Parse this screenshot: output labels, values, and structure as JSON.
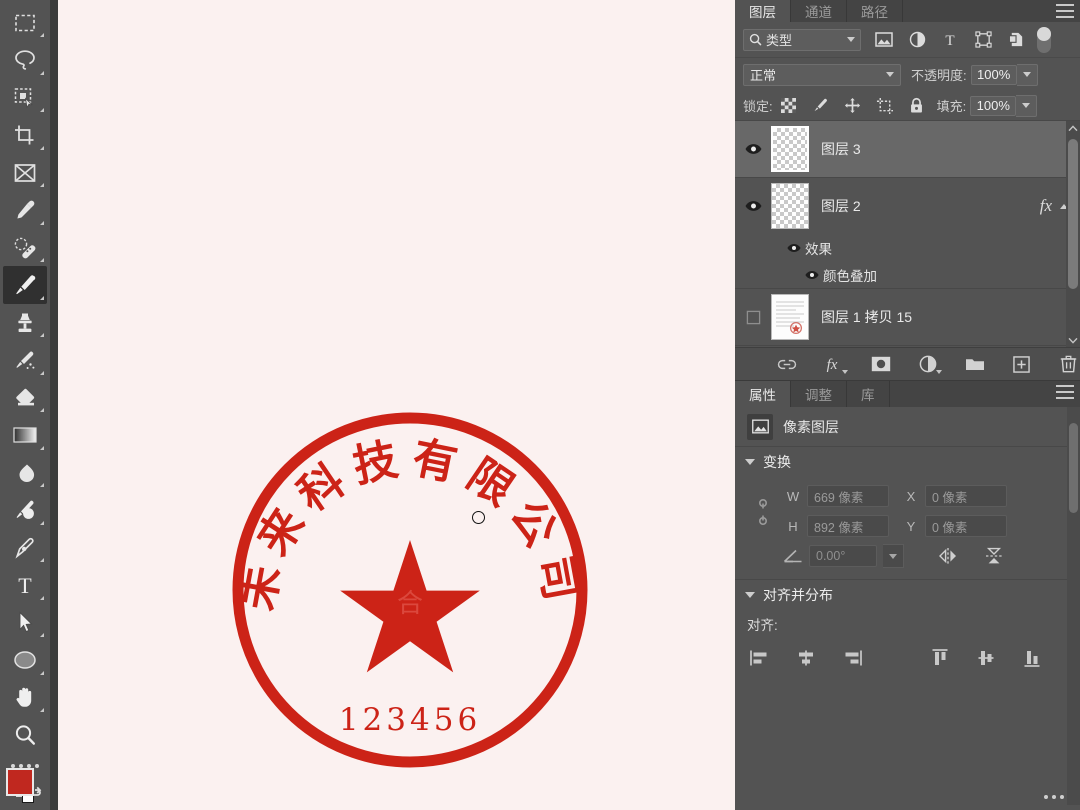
{
  "app": {
    "accent_red": "#cc2222",
    "canvas_bg": "#fbf1f0",
    "panel_bg": "#535353"
  },
  "toolbar": {
    "tools": [
      {
        "name": "rectangular-marquee-tool",
        "label": "矩形选框工具"
      },
      {
        "name": "lasso-tool",
        "label": "套索工具"
      },
      {
        "name": "quick-selection-tool",
        "label": "快速选择工具"
      },
      {
        "name": "crop-tool",
        "label": "裁剪工具"
      },
      {
        "name": "frame-tool",
        "label": "画框工具"
      },
      {
        "name": "eyedropper-tool",
        "label": "吸管工具"
      },
      {
        "name": "spot-healing-brush-tool",
        "label": "污点修复画笔工具"
      },
      {
        "name": "brush-tool",
        "label": "画笔工具"
      },
      {
        "name": "clone-stamp-tool",
        "label": "仿制图章工具"
      },
      {
        "name": "history-brush-tool",
        "label": "历史记录画笔工具"
      },
      {
        "name": "eraser-tool",
        "label": "橡皮擦工具"
      },
      {
        "name": "gradient-tool",
        "label": "渐变工具"
      },
      {
        "name": "blur-tool",
        "label": "模糊工具"
      },
      {
        "name": "dodge-tool",
        "label": "减淡工具"
      },
      {
        "name": "pen-tool",
        "label": "钢笔工具"
      },
      {
        "name": "type-tool",
        "label": "文字工具"
      },
      {
        "name": "path-selection-tool",
        "label": "路径选择工具"
      },
      {
        "name": "ellipse-tool",
        "label": "椭圆工具"
      },
      {
        "name": "hand-tool",
        "label": "抓手工具"
      },
      {
        "name": "zoom-tool",
        "label": "缩放工具"
      }
    ],
    "active_tool": "brush-tool",
    "more_tools_label": "编辑工具栏",
    "foreground_color": "#c0281f",
    "background_color": "#ffffff"
  },
  "canvas": {
    "seal": {
      "arc_text": "未来科技有限公司",
      "bottom_text": "123456",
      "center_text": "合",
      "color": "#cc2317"
    }
  },
  "layers_panel": {
    "tabs": [
      {
        "label": "图层",
        "active": true
      },
      {
        "label": "通道",
        "active": false
      },
      {
        "label": "路径",
        "active": false
      }
    ],
    "filter": {
      "kind_label": "类型",
      "icons": [
        "pixel-filter-icon",
        "adjustment-filter-icon",
        "text-filter-icon",
        "shape-filter-icon",
        "smartobject-filter-icon"
      ],
      "toggle_on": false
    },
    "blend_mode": "正常",
    "opacity_label": "不透明度:",
    "opacity_value": "100%",
    "lock_label": "锁定:",
    "lock_icons": [
      "lock-transparent-pixels-icon",
      "lock-image-pixels-icon",
      "lock-position-icon",
      "lock-artboard-nesting-icon",
      "lock-all-icon"
    ],
    "fill_label": "填充:",
    "fill_value": "100%",
    "layers": [
      {
        "name": "图层 3",
        "visible": true,
        "selected": true,
        "thumb": "checker",
        "has_fx": false,
        "effects": []
      },
      {
        "name": "图层 2",
        "visible": true,
        "selected": false,
        "thumb": "checker",
        "has_fx": true,
        "fx_label": "fx",
        "effects": [
          {
            "name": "效果",
            "visible": true,
            "indent": 1
          },
          {
            "name": "颜色叠加",
            "visible": true,
            "indent": 2
          }
        ]
      },
      {
        "name": "图层 1 拷贝 15",
        "visible": false,
        "selected": false,
        "thumb": "document",
        "has_fx": false,
        "effects": []
      }
    ],
    "bottom_tools": [
      {
        "name": "link-layers-button",
        "label": "链接图层"
      },
      {
        "name": "layer-style-button",
        "label": "添加图层样式"
      },
      {
        "name": "layer-mask-button",
        "label": "添加图层蒙版"
      },
      {
        "name": "adjustment-layer-button",
        "label": "创建新的填充或调整图层"
      },
      {
        "name": "new-group-button",
        "label": "创建新组"
      },
      {
        "name": "new-layer-button",
        "label": "创建新图层"
      },
      {
        "name": "delete-layer-button",
        "label": "删除图层"
      }
    ]
  },
  "properties_panel": {
    "tabs": [
      {
        "label": "属性",
        "active": true
      },
      {
        "label": "调整",
        "active": false
      },
      {
        "label": "库",
        "active": false
      }
    ],
    "layer_type": "像素图层",
    "transform": {
      "title": "变换",
      "w_key": "W",
      "w_value": "669 像素",
      "h_key": "H",
      "h_value": "892 像素",
      "x_key": "X",
      "x_value": "0 像素",
      "y_key": "Y",
      "y_value": "0 像素",
      "angle_value": "0.00°"
    },
    "align": {
      "title": "对齐并分布",
      "subtitle": "对齐:",
      "buttons": [
        {
          "name": "align-left-edges-button"
        },
        {
          "name": "align-horizontal-centers-button"
        },
        {
          "name": "align-right-edges-button"
        },
        {
          "name": "align-top-edges-button"
        },
        {
          "name": "align-vertical-centers-button"
        },
        {
          "name": "align-bottom-edges-button"
        }
      ],
      "more_label": "更多"
    }
  }
}
